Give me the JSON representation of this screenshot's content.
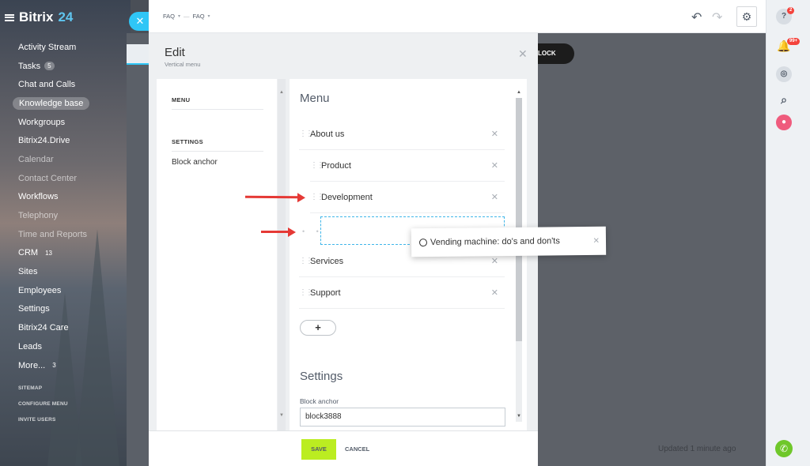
{
  "app": {
    "logo_text": "Bitrix",
    "logo_number": "24"
  },
  "sidebar": {
    "items": [
      {
        "label": "Activity Stream",
        "badge": ""
      },
      {
        "label": "Tasks",
        "badge": "5"
      },
      {
        "label": "Chat and Calls",
        "badge": ""
      },
      {
        "label": "Knowledge base",
        "badge": ""
      },
      {
        "label": "Workgroups",
        "badge": ""
      },
      {
        "label": "Bitrix24.Drive",
        "badge": ""
      },
      {
        "label": "Calendar",
        "badge": ""
      },
      {
        "label": "Contact Center",
        "badge": ""
      },
      {
        "label": "Workflows",
        "badge": ""
      },
      {
        "label": "Telephony",
        "badge": ""
      },
      {
        "label": "Time and Reports",
        "badge": ""
      },
      {
        "label": "CRM",
        "badge": "13"
      },
      {
        "label": "Sites",
        "badge": ""
      },
      {
        "label": "Employees",
        "badge": ""
      },
      {
        "label": "Settings",
        "badge": ""
      },
      {
        "label": "Bitrix24 Care",
        "badge": ""
      },
      {
        "label": "Leads",
        "badge": ""
      },
      {
        "label": "More...",
        "badge": "3"
      }
    ],
    "system": [
      "SITEMAP",
      "CONFIGURE MENU",
      "INVITE USERS"
    ]
  },
  "topbar": {
    "breadcrumb_1": "FAQ",
    "breadcrumb_sep": "—",
    "breadcrumb_2": "FAQ"
  },
  "rightbar": {
    "help_badge": "2",
    "notify_badge": "99+"
  },
  "background": {
    "block_button": "LOCK",
    "updated_text": "Updated 1 minute ago"
  },
  "panel": {
    "title": "Edit",
    "subtitle": "Vertical menu",
    "nav": {
      "menu_head": "MENU",
      "settings_head": "SETTINGS",
      "block_anchor": "Block anchor"
    },
    "menu_title": "Menu",
    "menu_items": [
      {
        "label": "About us"
      },
      {
        "label": "Product"
      },
      {
        "label": "Development"
      },
      {
        "label": "Services"
      },
      {
        "label": "Support"
      }
    ],
    "add_label": "+",
    "settings_title": "Settings",
    "anchor_label": "Block anchor",
    "anchor_value": "block3888",
    "save_label": "SAVE",
    "cancel_label": "CANCEL"
  },
  "drag_item": {
    "label": "Vending machine: do's and don'ts"
  }
}
